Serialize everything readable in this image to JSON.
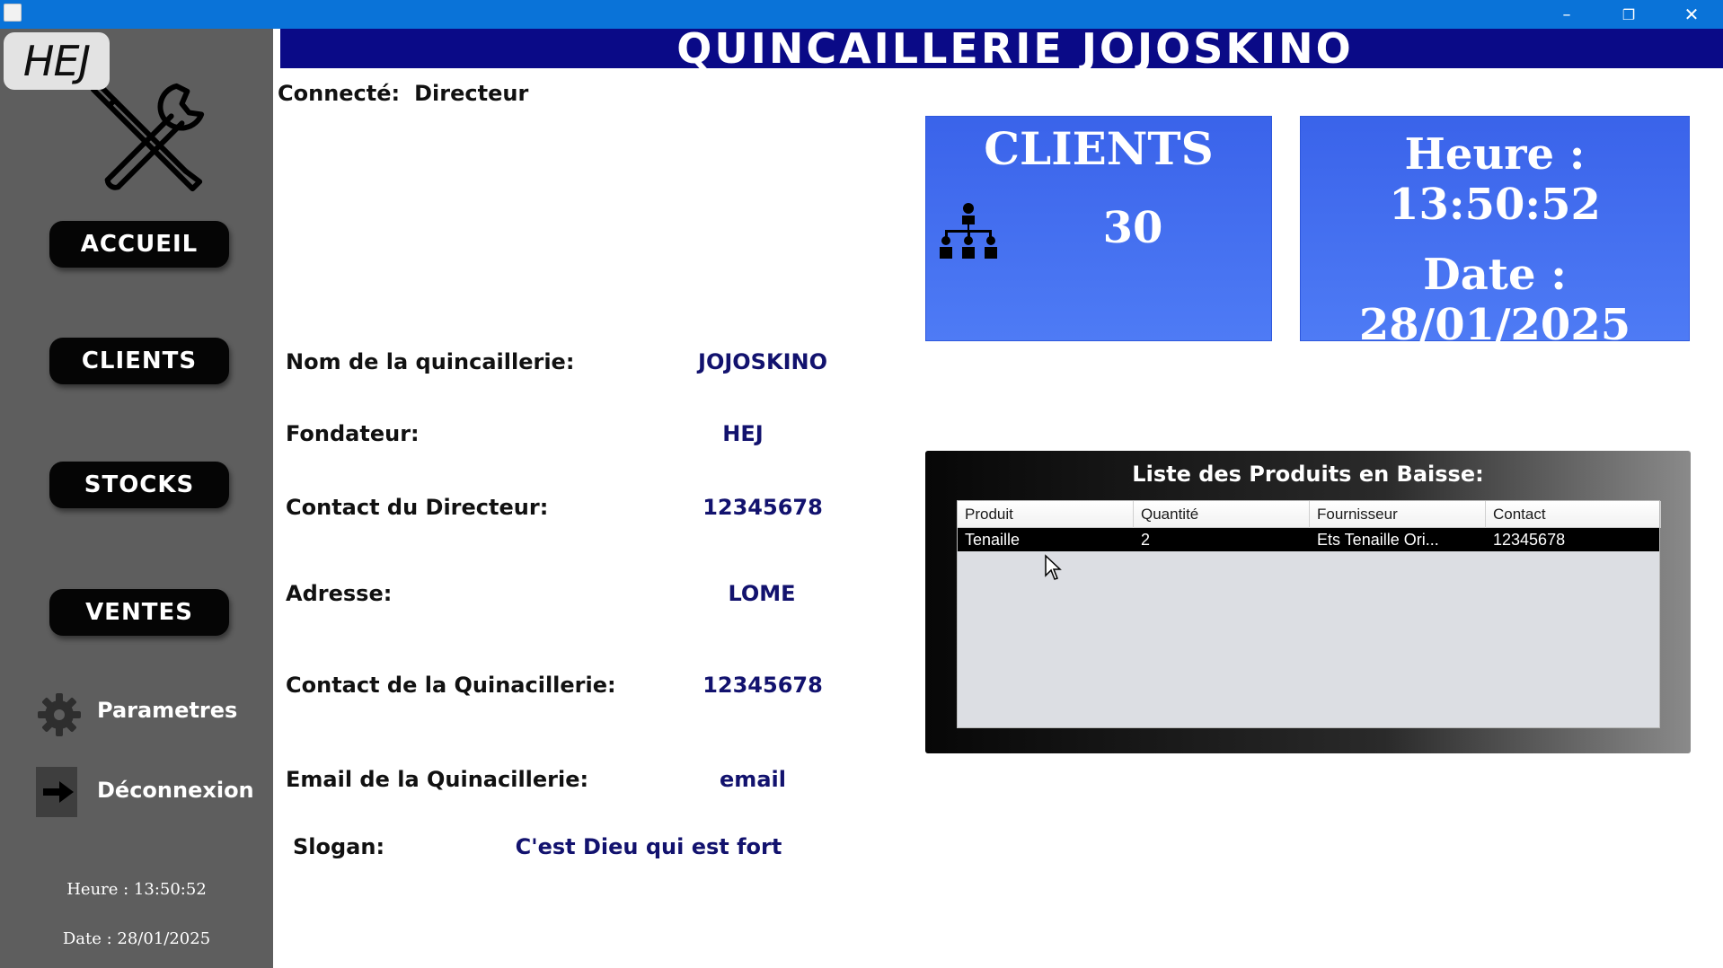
{
  "window": {
    "minimize_glyph": "–",
    "maximize_glyph": "❐",
    "close_glyph": "✕"
  },
  "sidebar": {
    "logo_text": "HEJ",
    "nav": {
      "accueil": "ACCUEIL",
      "clients": "CLIENTS",
      "stocks": "STOCKS",
      "ventes": "VENTES"
    },
    "parametres": "Parametres",
    "deconnexion": "Déconnexion",
    "heure": "Heure : 13:50:52",
    "date": "Date : 28/01/2025"
  },
  "header": {
    "title": "QUINCAILLERIE JOJOSKINO"
  },
  "session": {
    "connected_label": "Connecté:",
    "role": "Directeur"
  },
  "info": {
    "nom_label": "Nom de la quincaillerie:",
    "nom_value": "JOJOSKINO",
    "fondateur_label": "Fondateur:",
    "fondateur_value": "HEJ",
    "contact_dir_label": "Contact du Directeur:",
    "contact_dir_value": "12345678",
    "adresse_label": "Adresse:",
    "adresse_value": "LOME",
    "contact_quin_label": "Contact de la Quinacillerie:",
    "contact_quin_value": "12345678",
    "email_label": "Email de la Quinacillerie:",
    "email_value": "email",
    "slogan_label": "Slogan:",
    "slogan_value": "C'est Dieu qui est fort"
  },
  "cards": {
    "clients_title": "CLIENTS",
    "clients_count": "30",
    "heure": "Heure : 13:50:52",
    "date": "Date : 28/01/2025"
  },
  "low_stock": {
    "title": "Liste des Produits en Baisse:",
    "columns": [
      "Produit",
      "Quantité",
      "Fournisseur",
      "Contact"
    ],
    "rows": [
      [
        "Tenaille",
        "2",
        "Ets Tenaille Ori...",
        "12345678"
      ]
    ]
  },
  "colors": {
    "titlebar": "#0a73d8",
    "sidebar": "#5e5e5e",
    "banner": "#0a0a87",
    "card_blue": "#3a63ea",
    "value_text": "#12126e"
  }
}
